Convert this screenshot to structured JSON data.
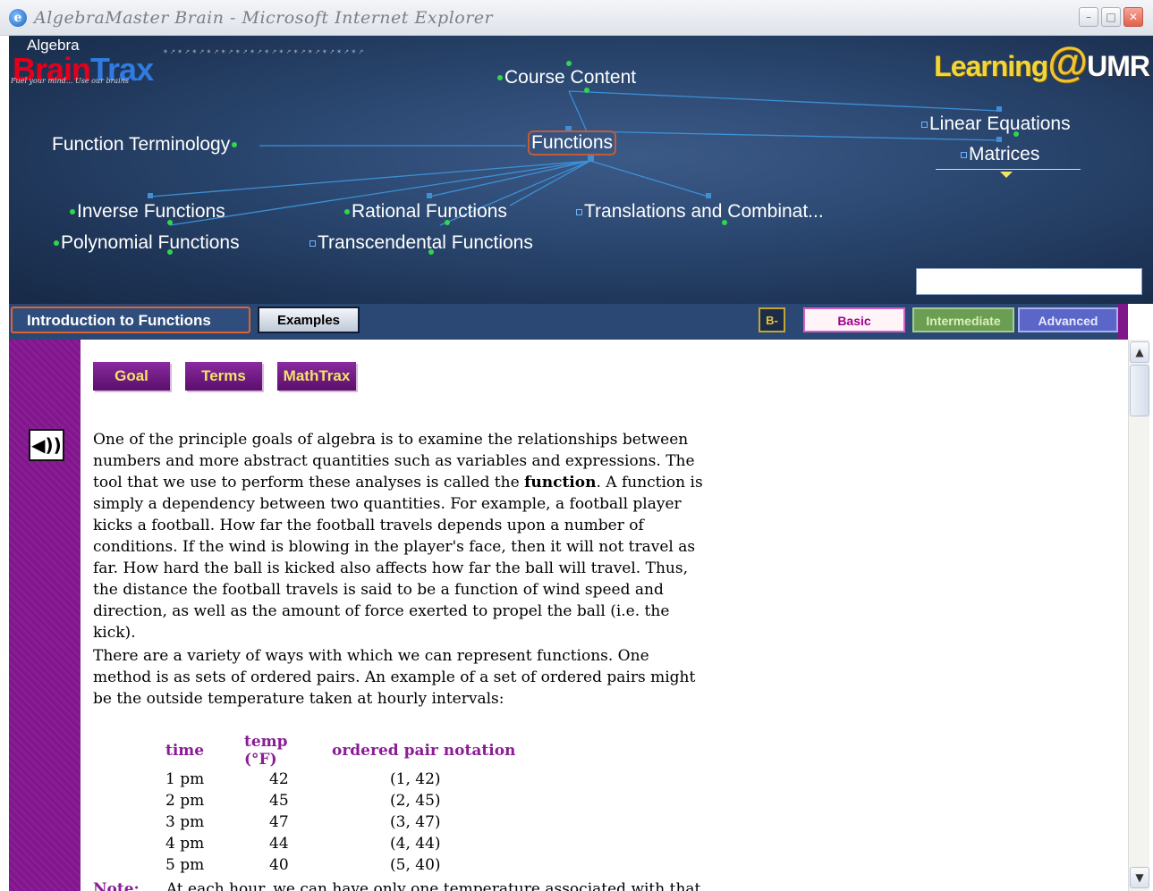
{
  "window": {
    "title": "AlgebraMaster Brain - Microsoft Internet Explorer"
  },
  "banner": {
    "logo_algebra": "Algebra",
    "logo_brain": "Brain",
    "logo_trax": "Trax",
    "logo_tagline": "Fuel your mind... Use our brains",
    "learning_logo": "Learning",
    "learning_at": "@",
    "learning_umr": "UMR",
    "nodes": {
      "course_content": "Course Content",
      "function_terminology": "Function Terminology",
      "functions": "Functions",
      "linear_equations": "Linear Equations",
      "matrices": "Matrices",
      "inverse_functions": "Inverse Functions",
      "rational_functions": "Rational Functions",
      "translations": "Translations and Combinat...",
      "polynomial_functions": "Polynomial Functions",
      "transcendental_functions": "Transcendental Functions"
    },
    "search_value": ""
  },
  "nav": {
    "intro_tab": "Introduction to Functions",
    "examples_tab": "Examples",
    "b_button": "B-",
    "basic": "Basic",
    "intermediate": "Intermediate",
    "advanced": "Advanced"
  },
  "content": {
    "buttons": {
      "goal": "Goal",
      "terms": "Terms",
      "mathtrax": "MathTrax"
    },
    "para1_a": "One of the principle goals of algebra is to examine the relationships between numbers and more abstract quantities such as variables and expressions.  The tool that we use to perform these analyses is called the ",
    "para1_bold": "function",
    "para1_b": ". A function is simply a dependency between two quantities.  For example, a football player kicks a football.  How far the football travels depends upon a number of conditions.  If the wind is blowing in the player's face, then it will not travel as far.  How hard the ball is kicked also affects how far the ball will travel.  Thus, the distance the football travels is said to be a function of wind speed and direction, as well as the amount of force exerted to propel the ball (i.e. the kick).",
    "para2": "There are a variety of ways with which we can represent functions. One method is as sets of ordered pairs. An example of a set of ordered pairs might be the outside temperature taken at hourly intervals:",
    "table": {
      "headers": [
        "time",
        "temp (°F)",
        "ordered pair notation"
      ],
      "rows": [
        [
          "1 pm",
          "42",
          "(1, 42)"
        ],
        [
          "2 pm",
          "45",
          "(2, 45)"
        ],
        [
          "3 pm",
          "47",
          "(3, 47)"
        ],
        [
          "4 pm",
          "44",
          "(4, 44)"
        ],
        [
          "5 pm",
          "40",
          "(5, 40)"
        ]
      ]
    },
    "note_label": "Note:",
    "note_text": "At each hour, we can have only one temperature associated with that"
  },
  "icons": {
    "speaker": "speaker-icon",
    "ie": "ie-icon"
  }
}
